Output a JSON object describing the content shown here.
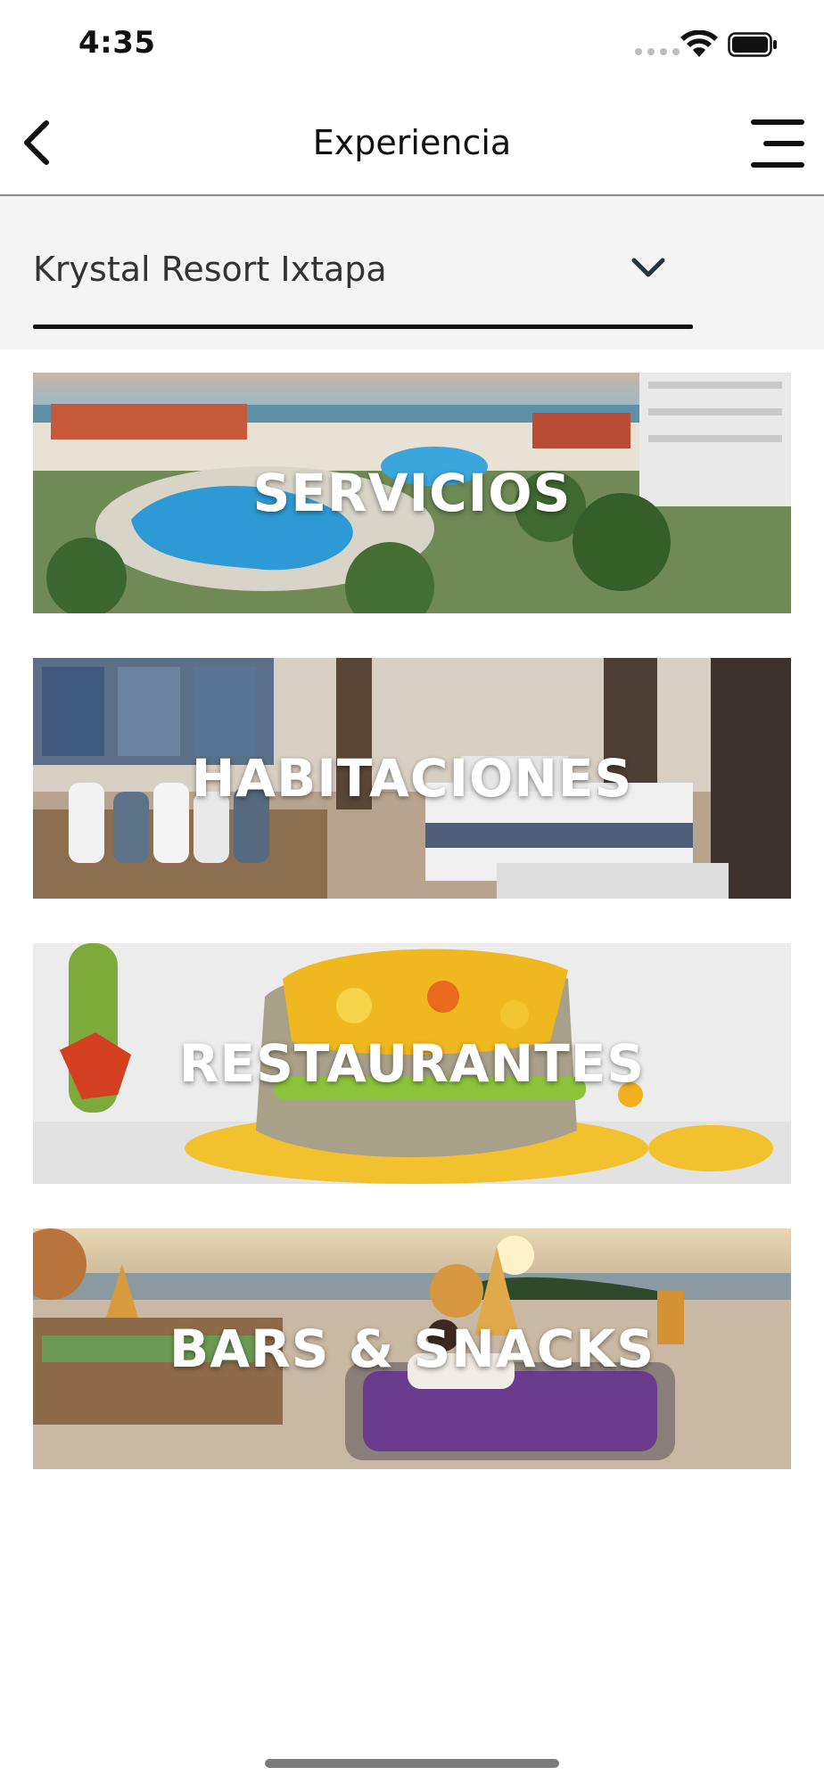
{
  "status_bar": {
    "time": "4:35"
  },
  "nav": {
    "title": "Experiencia"
  },
  "selector": {
    "value": "Krystal Resort Ixtapa"
  },
  "cards": [
    {
      "label": "SERVICIOS"
    },
    {
      "label": "HABITACIONES"
    },
    {
      "label": "RESTAURANTES"
    },
    {
      "label": "BARS & SNACKS"
    }
  ],
  "icons": {
    "back": "chevron-left-icon",
    "menu": "hamburger-menu-icon",
    "dropdown": "chevron-down-icon",
    "wifi": "wifi-icon",
    "battery": "battery-icon"
  }
}
